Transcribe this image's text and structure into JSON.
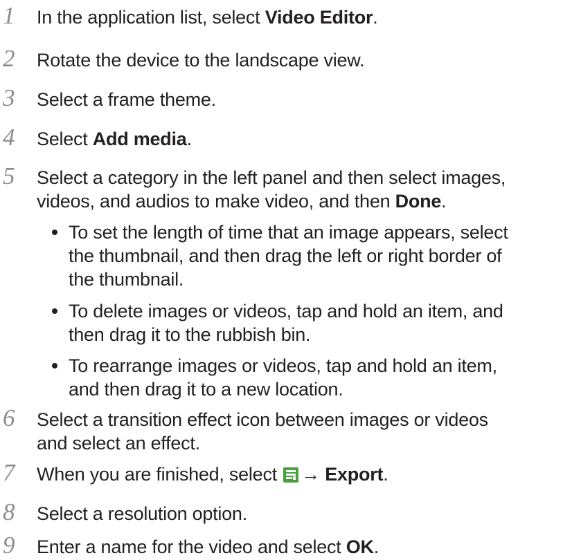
{
  "steps": [
    {
      "num": "1",
      "pre": "In the application list, select ",
      "bold": "Video Editor",
      "post": "."
    },
    {
      "num": "2",
      "text": "Rotate the device to the landscape view."
    },
    {
      "num": "3",
      "text": "Select a frame theme."
    },
    {
      "num": "4",
      "pre": "Select ",
      "bold": "Add media",
      "post": "."
    },
    {
      "num": "5",
      "line1": "Select a category in the left panel and then select images,",
      "line2_pre": "videos, and audios to make video, and then ",
      "bold": "Done",
      "post": "."
    },
    {
      "num": "6",
      "line1": "Select a transition effect icon between images or videos",
      "line2": "and select an effect."
    },
    {
      "num": "7",
      "pre": "When you are finished, select ",
      "icon": "menu-icon",
      "arrow": "→",
      "bold": "Export",
      "post": "."
    },
    {
      "num": "8",
      "text": "Select a resolution option."
    },
    {
      "num": "9",
      "pre": "Enter a name for the video and select ",
      "bold": "OK",
      "post": "."
    }
  ],
  "bullets": [
    {
      "lines": [
        "To set the length of time that an image appears, select",
        "the thumbnail, and then drag the left or right border of",
        "the thumbnail."
      ]
    },
    {
      "lines": [
        "To delete images or videos, tap and hold an item, and",
        "then drag it to the rubbish bin."
      ]
    },
    {
      "lines": [
        "To rearrange images or videos, tap and hold an item,",
        "and then drag it to a new location."
      ]
    }
  ],
  "colors": {
    "text": "#231f20",
    "step_number": "#8a8c8e",
    "icon_bg": "#4aa03f"
  }
}
